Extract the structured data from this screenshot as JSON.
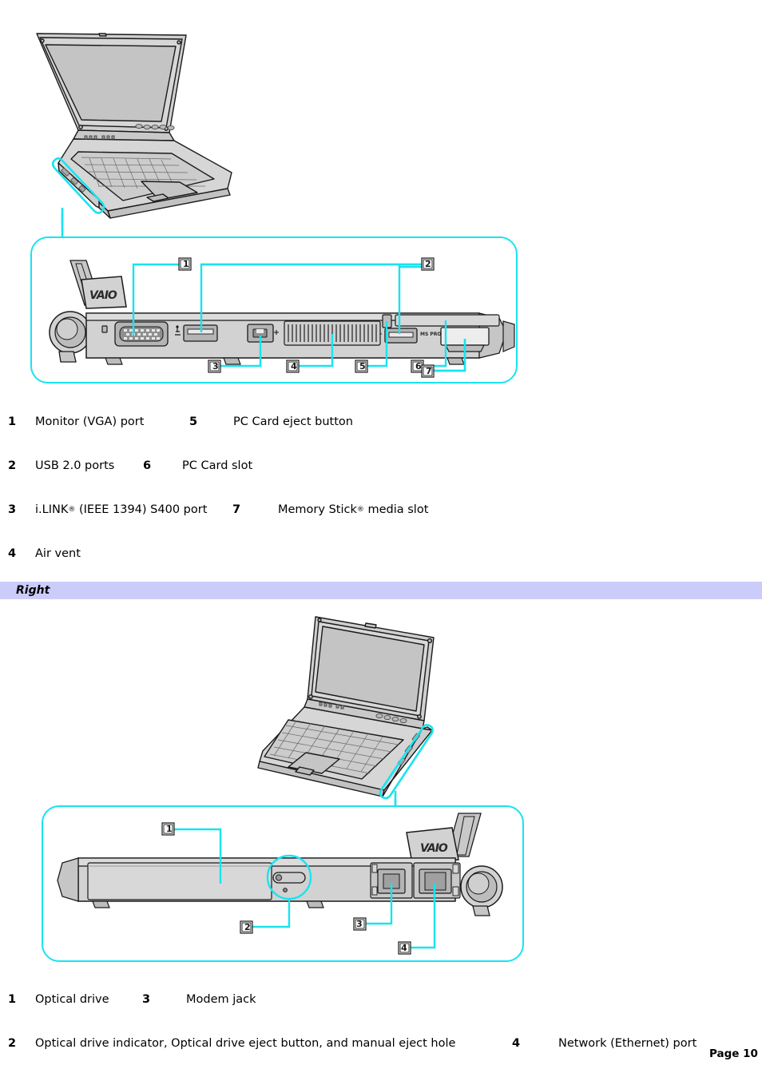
{
  "document": {
    "page_label": "Page 10"
  },
  "sections": [
    {
      "id": "left-side",
      "figure": {
        "name": "vaio-laptop-left-side-view",
        "callout_markers": [
          "1",
          "2",
          "3",
          "4",
          "5",
          "6",
          "7"
        ],
        "brand_text": "VAIO",
        "slot_label": "MS PRO"
      },
      "parts": [
        {
          "num_a": "1",
          "label_a": "Monitor (VGA) port",
          "num_b": "5",
          "label_b": "PC Card eject button"
        },
        {
          "num_a": "2",
          "label_a": "USB 2.0 ports",
          "num_b": "6",
          "label_b": "PC Card slot"
        },
        {
          "num_a": "3",
          "label_a_pre": "i.LINK",
          "label_a_reg": "®",
          "label_a_post": " (IEEE 1394) S400 port",
          "num_b": "7",
          "label_b_pre": "Memory Stick",
          "label_b_reg": "®",
          "label_b_post": " media slot"
        },
        {
          "num_a": "4",
          "label_a": "Air vent",
          "num_b": "",
          "label_b": ""
        }
      ]
    },
    {
      "id": "right-side",
      "band_title": "Right",
      "figure": {
        "name": "vaio-laptop-right-side-view",
        "callout_markers": [
          "1",
          "2",
          "3",
          "4"
        ],
        "brand_text": "VAIO"
      },
      "parts": [
        {
          "num_a": "1",
          "label_a": "Optical drive",
          "num_b": "3",
          "label_b": "Modem jack"
        },
        {
          "num_a": "2",
          "label_a": "Optical drive indicator, Optical drive eject button, and manual eject hole",
          "num_b": "4",
          "label_b": "Network (Ethernet) port"
        }
      ]
    }
  ],
  "colors": {
    "callout_cyan": "#19E3F0",
    "band_background": "#ccccfb",
    "illustration_fill": "#d3d3d3",
    "illustration_stroke": "#1a1a1a",
    "text": "#000000"
  }
}
